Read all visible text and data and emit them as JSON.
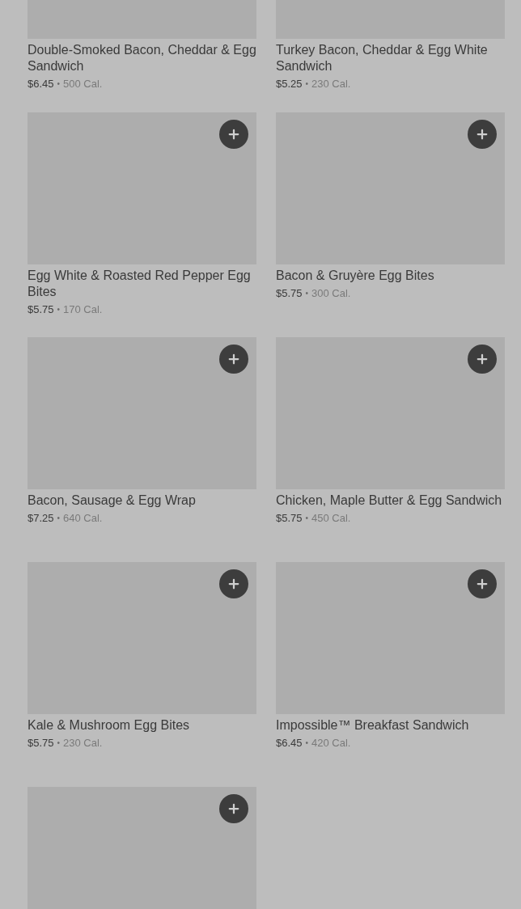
{
  "items": [
    {
      "kind": "cut_top",
      "name": "Double-Smoked Bacon, Cheddar & Egg Sandwich",
      "price": "$6.45",
      "separator": "•",
      "calories": "500 Cal."
    },
    {
      "kind": "cut_top",
      "name": "Turkey Bacon, Cheddar & Egg White Sandwich",
      "price": "$5.25",
      "separator": "•",
      "calories": "230 Cal."
    },
    {
      "kind": "full",
      "name": "Egg White & Roasted Red Pepper Egg Bites",
      "price": "$5.75",
      "separator": "•",
      "calories": "170 Cal."
    },
    {
      "kind": "full",
      "name": "Bacon & Gruyère Egg Bites",
      "price": "$5.75",
      "separator": "•",
      "calories": "300 Cal."
    },
    {
      "kind": "full",
      "name": "Bacon, Sausage & Egg Wrap",
      "price": "$7.25",
      "separator": "•",
      "calories": "640 Cal."
    },
    {
      "kind": "full",
      "name": "Chicken, Maple Butter & Egg Sandwich",
      "price": "$5.75",
      "separator": "•",
      "calories": "450 Cal."
    },
    {
      "kind": "full",
      "name": "Kale & Mushroom Egg Bites",
      "price": "$5.75",
      "separator": "•",
      "calories": "230 Cal."
    },
    {
      "kind": "full",
      "name": "Impossible™ Breakfast Sandwich",
      "price": "$6.45",
      "separator": "•",
      "calories": "420 Cal."
    },
    {
      "kind": "cut_bottom"
    }
  ]
}
